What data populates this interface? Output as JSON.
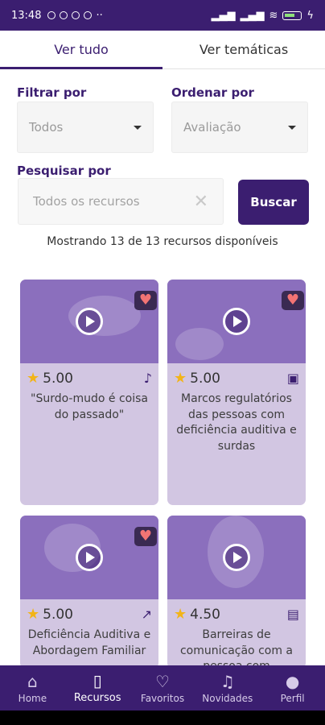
{
  "status_bar": {
    "time": "13:48"
  },
  "tabs": [
    {
      "label": "Ver tudo",
      "active": true
    },
    {
      "label": "Ver temáticas",
      "active": false
    }
  ],
  "filter": {
    "label": "Filtrar por",
    "value": "Todos"
  },
  "sort": {
    "label": "Ordenar por",
    "value": "Avaliação"
  },
  "search": {
    "label": "Pesquisar por",
    "placeholder": "Todos os recursos",
    "button_label": "Buscar"
  },
  "results_text": "Mostrando 13 de 13 recursos disponíveis",
  "cards": [
    {
      "rating": "5.00",
      "title": "\"Surdo-mudo é coisa do passado\"",
      "type_icon": "music-icon",
      "type_glyph": "♪",
      "favorited": true
    },
    {
      "rating": "5.00",
      "title": "Marcos regulatórios das pessoas com deficiência auditiva e surdas",
      "type_icon": "gallery-icon",
      "type_glyph": "▣",
      "favorited": true
    },
    {
      "rating": "5.00",
      "title": "Deficiência Auditiva e Abordagem Familiar",
      "type_icon": "trending-icon",
      "type_glyph": "↗",
      "favorited": true
    },
    {
      "rating": "4.50",
      "title": "Barreiras de comunicação com a pessoa com",
      "type_icon": "book-icon",
      "type_glyph": "▤",
      "favorited": false
    }
  ],
  "nav": [
    {
      "label": "Home",
      "icon": "home-icon",
      "glyph": "⌂",
      "active": false
    },
    {
      "label": "Recursos",
      "icon": "tablet-icon",
      "glyph": "▯",
      "active": true
    },
    {
      "label": "Favoritos",
      "icon": "heart-icon",
      "glyph": "♡",
      "active": false
    },
    {
      "label": "Novidades",
      "icon": "bell-icon",
      "glyph": "🔔",
      "active": false
    },
    {
      "label": "Perfil",
      "icon": "person-icon",
      "glyph": "●",
      "active": false
    }
  ],
  "colors": {
    "primary": "#3b1e70",
    "card_background": "#d2c6e2",
    "star": "#f2b418",
    "heart": "#f27474"
  }
}
